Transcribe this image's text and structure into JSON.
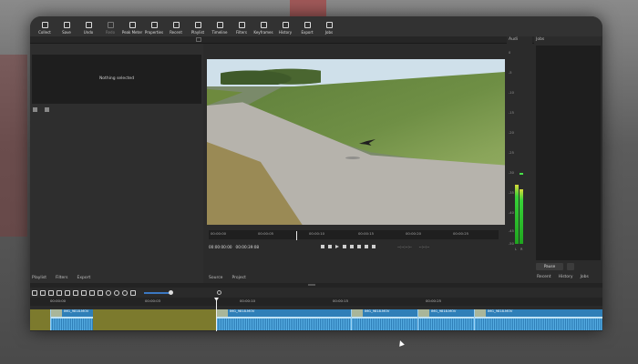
{
  "toolbar": {
    "items": [
      {
        "label": "Collect",
        "icon": "collection-icon",
        "enabled": true
      },
      {
        "label": "Save",
        "icon": "save-icon",
        "enabled": true
      },
      {
        "label": "Undo",
        "icon": "undo-icon",
        "enabled": true
      },
      {
        "label": "Redo",
        "icon": "redo-icon",
        "enabled": false
      },
      {
        "label": "Peak Meter",
        "icon": "peak-meter-icon",
        "enabled": true
      },
      {
        "label": "Properties",
        "icon": "properties-icon",
        "enabled": true
      },
      {
        "label": "Recent",
        "icon": "recent-icon",
        "enabled": true
      },
      {
        "label": "Playlist",
        "icon": "playlist-icon",
        "enabled": true
      },
      {
        "label": "Timeline",
        "icon": "timeline-icon",
        "enabled": true
      },
      {
        "label": "Filters",
        "icon": "filters-icon",
        "enabled": true
      },
      {
        "label": "Keyframes",
        "icon": "keyframes-icon",
        "enabled": true
      },
      {
        "label": "History",
        "icon": "history-icon",
        "enabled": true
      },
      {
        "label": "Export",
        "icon": "export-icon",
        "enabled": true
      },
      {
        "label": "Jobs",
        "icon": "jobs-icon",
        "enabled": true
      }
    ]
  },
  "properties": {
    "empty_text": "Nothing selected"
  },
  "left_tabs": [
    "Playlist",
    "Filters",
    "Export"
  ],
  "player": {
    "ruler": [
      "00:00:00",
      "00:00:05",
      "00:00:10",
      "00:00:15",
      "00:00:20",
      "00:00:25"
    ],
    "timecode_current": "00:00:00:00",
    "timecode_total": "00:00:39:08",
    "in_out_left": "--:--:--:--",
    "in_out_right": "--:--:--",
    "tabs": [
      "Source",
      "Project"
    ]
  },
  "audio": {
    "title": "Audi",
    "scale": [
      "0",
      "-5",
      "-10",
      "-15",
      "-20",
      "-25",
      "-30",
      "-35",
      "-40",
      "-45",
      "-50"
    ],
    "channel_left": "L",
    "channel_right": "R",
    "level_left_db": -18,
    "level_right_db": -20
  },
  "jobs": {
    "title": "Jobs",
    "pause_label": "Pause",
    "tabs": [
      "Recent",
      "History",
      "Jobs"
    ]
  },
  "timeline": {
    "ruler": [
      "00:00:00",
      "00:00:03",
      "00:00:10",
      "00:00:15",
      "00:00:25"
    ],
    "clips": [
      {
        "name": "IMG_9818.MOV",
        "kind": "clip"
      },
      {
        "name": "",
        "kind": "gap"
      },
      {
        "name": "IMG_9818.MOV",
        "kind": "clip"
      },
      {
        "name": "IMG_9818.MOV",
        "kind": "clip"
      },
      {
        "name": "IMG_9818.MOV",
        "kind": "clip"
      },
      {
        "name": "IMG_9818.MOV",
        "kind": "clip"
      },
      {
        "name": "IMG_9818.MOV",
        "kind": "clip"
      }
    ]
  },
  "colors": {
    "accent": "#2f7fb8",
    "gap": "#7c7a2d",
    "meter_green": "#38d238",
    "panel": "#2b2b2b"
  }
}
